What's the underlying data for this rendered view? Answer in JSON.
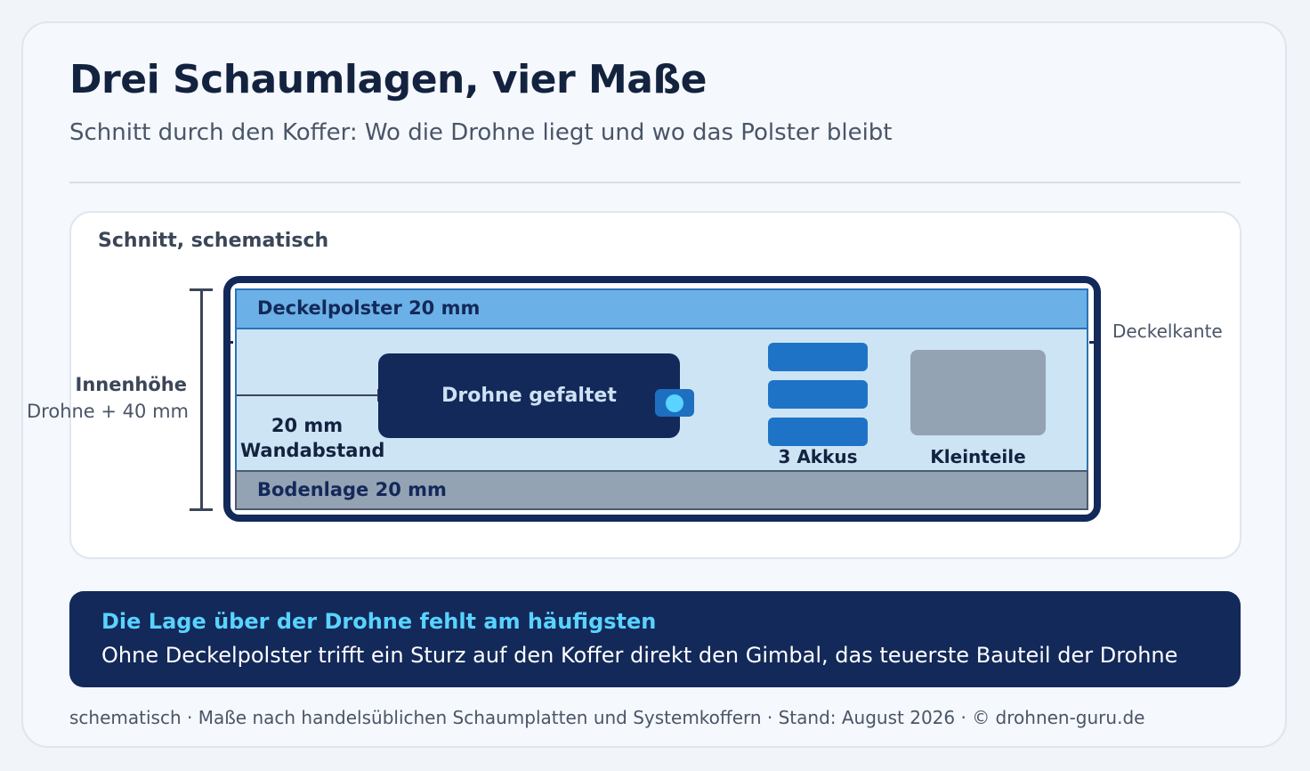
{
  "header": {
    "title": "Drei Schaumlagen, vier Maße",
    "subtitle": "Schnitt durch den Koffer: Wo die Drohne liegt und wo das Polster bleibt"
  },
  "diagram": {
    "panel_label": "Schnitt, schematisch",
    "inner_height_title": "Innenhöhe",
    "inner_height_value": "Drohne + 40 mm",
    "lid_foam": "Deckelpolster 20 mm",
    "lid_edge": "Deckelkante",
    "bottom_foam": "Bodenlage 20 mm",
    "wall_gap_value": "20 mm",
    "wall_gap_label": "Wandabstand",
    "drone": "Drohne gefaltet",
    "batteries": "3 Akkus",
    "small_parts": "Kleinteile"
  },
  "callout": {
    "title": "Die Lage über der Drohne fehlt am häufigsten",
    "body": "Ohne Deckelpolster trifft ein Sturz auf den Koffer direkt den Gimbal, das teuerste Bauteil der Drohne"
  },
  "footer": {
    "note": "schematisch · Maße nach handelsüblichen Schaumplatten und Systemkoffern · Stand: August 2026 · © drohnen-guru.de"
  },
  "colors": {
    "navy": "#13295a",
    "lid_foam": "#6bb1e7",
    "interior": "#cde4f5",
    "bottom_foam": "#94a3b3",
    "accent": "#59d3ff",
    "battery": "#1f73c7"
  }
}
